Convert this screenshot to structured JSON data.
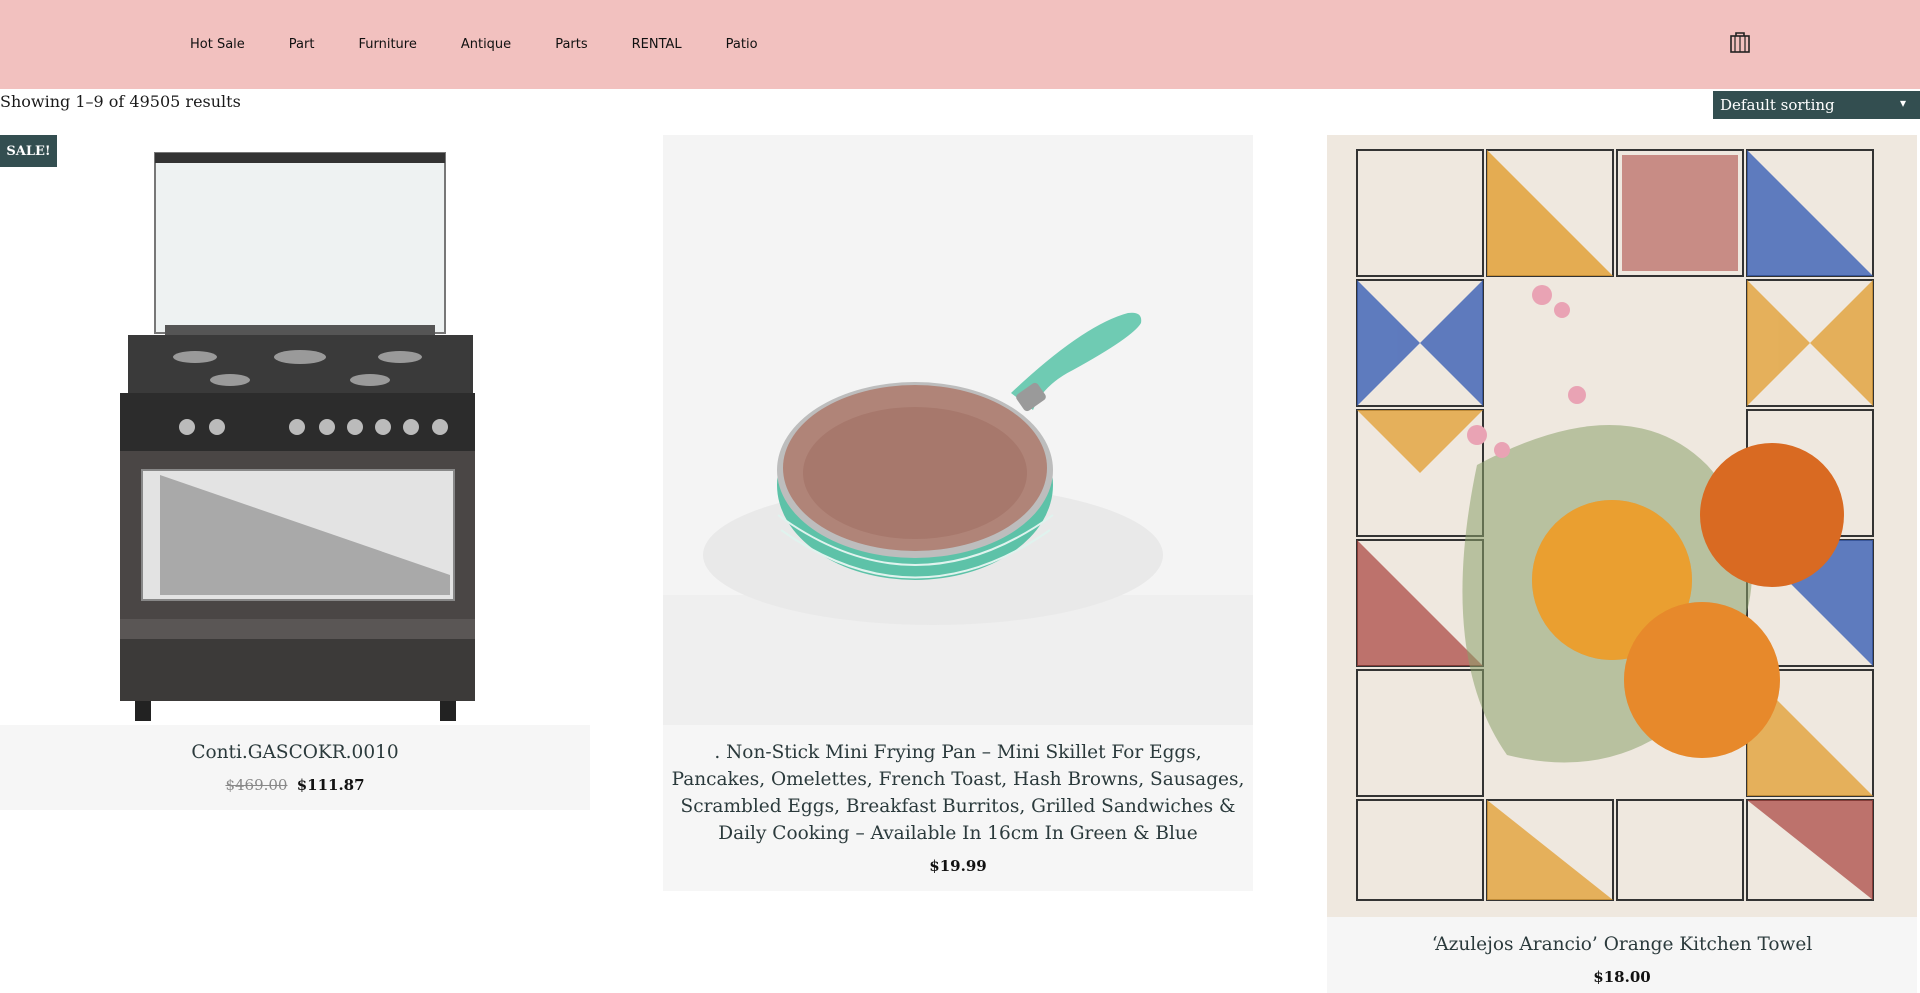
{
  "nav": {
    "items": [
      {
        "label": "Hot Sale"
      },
      {
        "label": "Part"
      },
      {
        "label": "Furniture"
      },
      {
        "label": "Antique"
      },
      {
        "label": "Parts"
      },
      {
        "label": "RENTAL"
      },
      {
        "label": "Patio"
      }
    ],
    "cart_icon": "shopping-bag-icon"
  },
  "toolbar": {
    "result_count": "Showing 1–9 of 49505 results",
    "sort_selected": "Default sorting"
  },
  "badge": {
    "sale_label": "SALE!"
  },
  "products": [
    {
      "title": "Conti.GASCOKR.0010",
      "old_price": "$469.00",
      "price": "$111.87",
      "image": "gas-range-oven"
    },
    {
      "title": ". Non-Stick Mini Frying Pan – Mini Skillet For Eggs, Pancakes, Omelettes, French Toast, Hash Browns, Sausages, Scrambled Eggs, Breakfast Burritos, Grilled Sandwiches & Daily Cooking – Available In 16cm In Green & Blue",
      "price": "$19.99",
      "image": "frying-pan"
    },
    {
      "title": "‘Azulejos Arancio’ Orange Kitchen Towel",
      "price": "$18.00",
      "image": "tile-orange-towel"
    }
  ],
  "colors": {
    "header_bg": "#f2c1bf",
    "accent": "#334e50",
    "card_info_bg": "#f6f6f6"
  }
}
